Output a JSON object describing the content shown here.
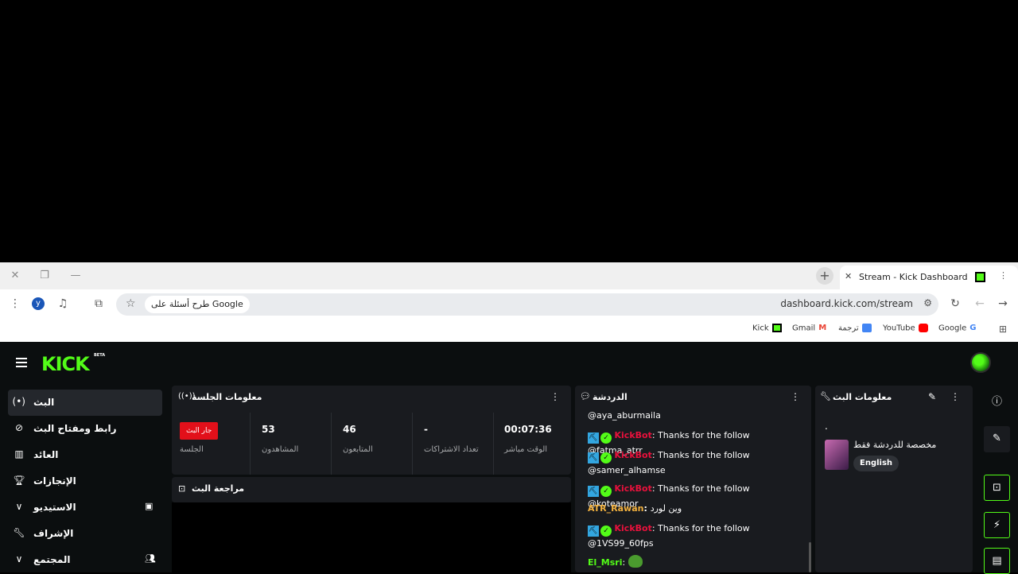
{
  "browser": {
    "tab_title": "Stream - Kick Dashboard",
    "url": "dashboard.kick.com/stream",
    "ask_google": "طرح أسئلة على Google",
    "profile_letter": "y",
    "bookmarks": [
      {
        "label": "Kick",
        "color": "#53fc18"
      },
      {
        "label": "Gmail",
        "color": "#ea4335"
      },
      {
        "label": "ترجمة",
        "color": "#4285f4"
      },
      {
        "label": "YouTube",
        "color": "#ff0000"
      },
      {
        "label": "Google",
        "color": "#4285f4"
      }
    ]
  },
  "app": {
    "logo": "KICK",
    "beta": "BETA",
    "accent": "#53fc18",
    "sidebar": [
      {
        "label": "البث",
        "icon": "broadcast-icon"
      },
      {
        "label": "رابط ومفتاح البث",
        "icon": "link-icon"
      },
      {
        "label": "العائد",
        "icon": "chart-icon"
      },
      {
        "label": "الإنجازات",
        "icon": "trophy-icon"
      },
      {
        "label": "الاستيديو",
        "icon": "studio-icon"
      },
      {
        "label": "الإشراف",
        "icon": "wrench-icon"
      },
      {
        "label": "المجتمع",
        "icon": "community-icon"
      }
    ],
    "session": {
      "title": "معلومات الجلسة",
      "live_badge": "جار البث",
      "session_label": "الجلسة",
      "stats": [
        {
          "value": "53",
          "label": "المشاهدون"
        },
        {
          "value": "46",
          "label": "المتابعون"
        },
        {
          "value": "-",
          "label": "تعداد الاشتراكات"
        },
        {
          "value": "00:07:36",
          "label": "الوقت مباشر"
        }
      ]
    },
    "review": {
      "title": "مراجعة البث"
    },
    "chat": {
      "title": "الدردشة",
      "messages": [
        {
          "text": "@aya_aburmaila"
        },
        {
          "user": "KickBot",
          "text": ": Thanks for the follow @fatma_atrr"
        },
        {
          "user": "KickBot",
          "text": ": Thanks for the follow @samer_alhamse"
        },
        {
          "user": "KickBot",
          "text": ": Thanks for the follow @koteamor"
        },
        {
          "user": "ATR_Rawan",
          "text": "وين لورد"
        },
        {
          "user": "KickBot",
          "text": ": Thanks for the follow @1VS99_60fps"
        },
        {
          "user": "El_Msri",
          "text": ":"
        }
      ]
    },
    "stream_info": {
      "title": "معلومات البث",
      "dot": ".",
      "category": "مخصصة للدردشة فقط",
      "language": "English"
    }
  }
}
